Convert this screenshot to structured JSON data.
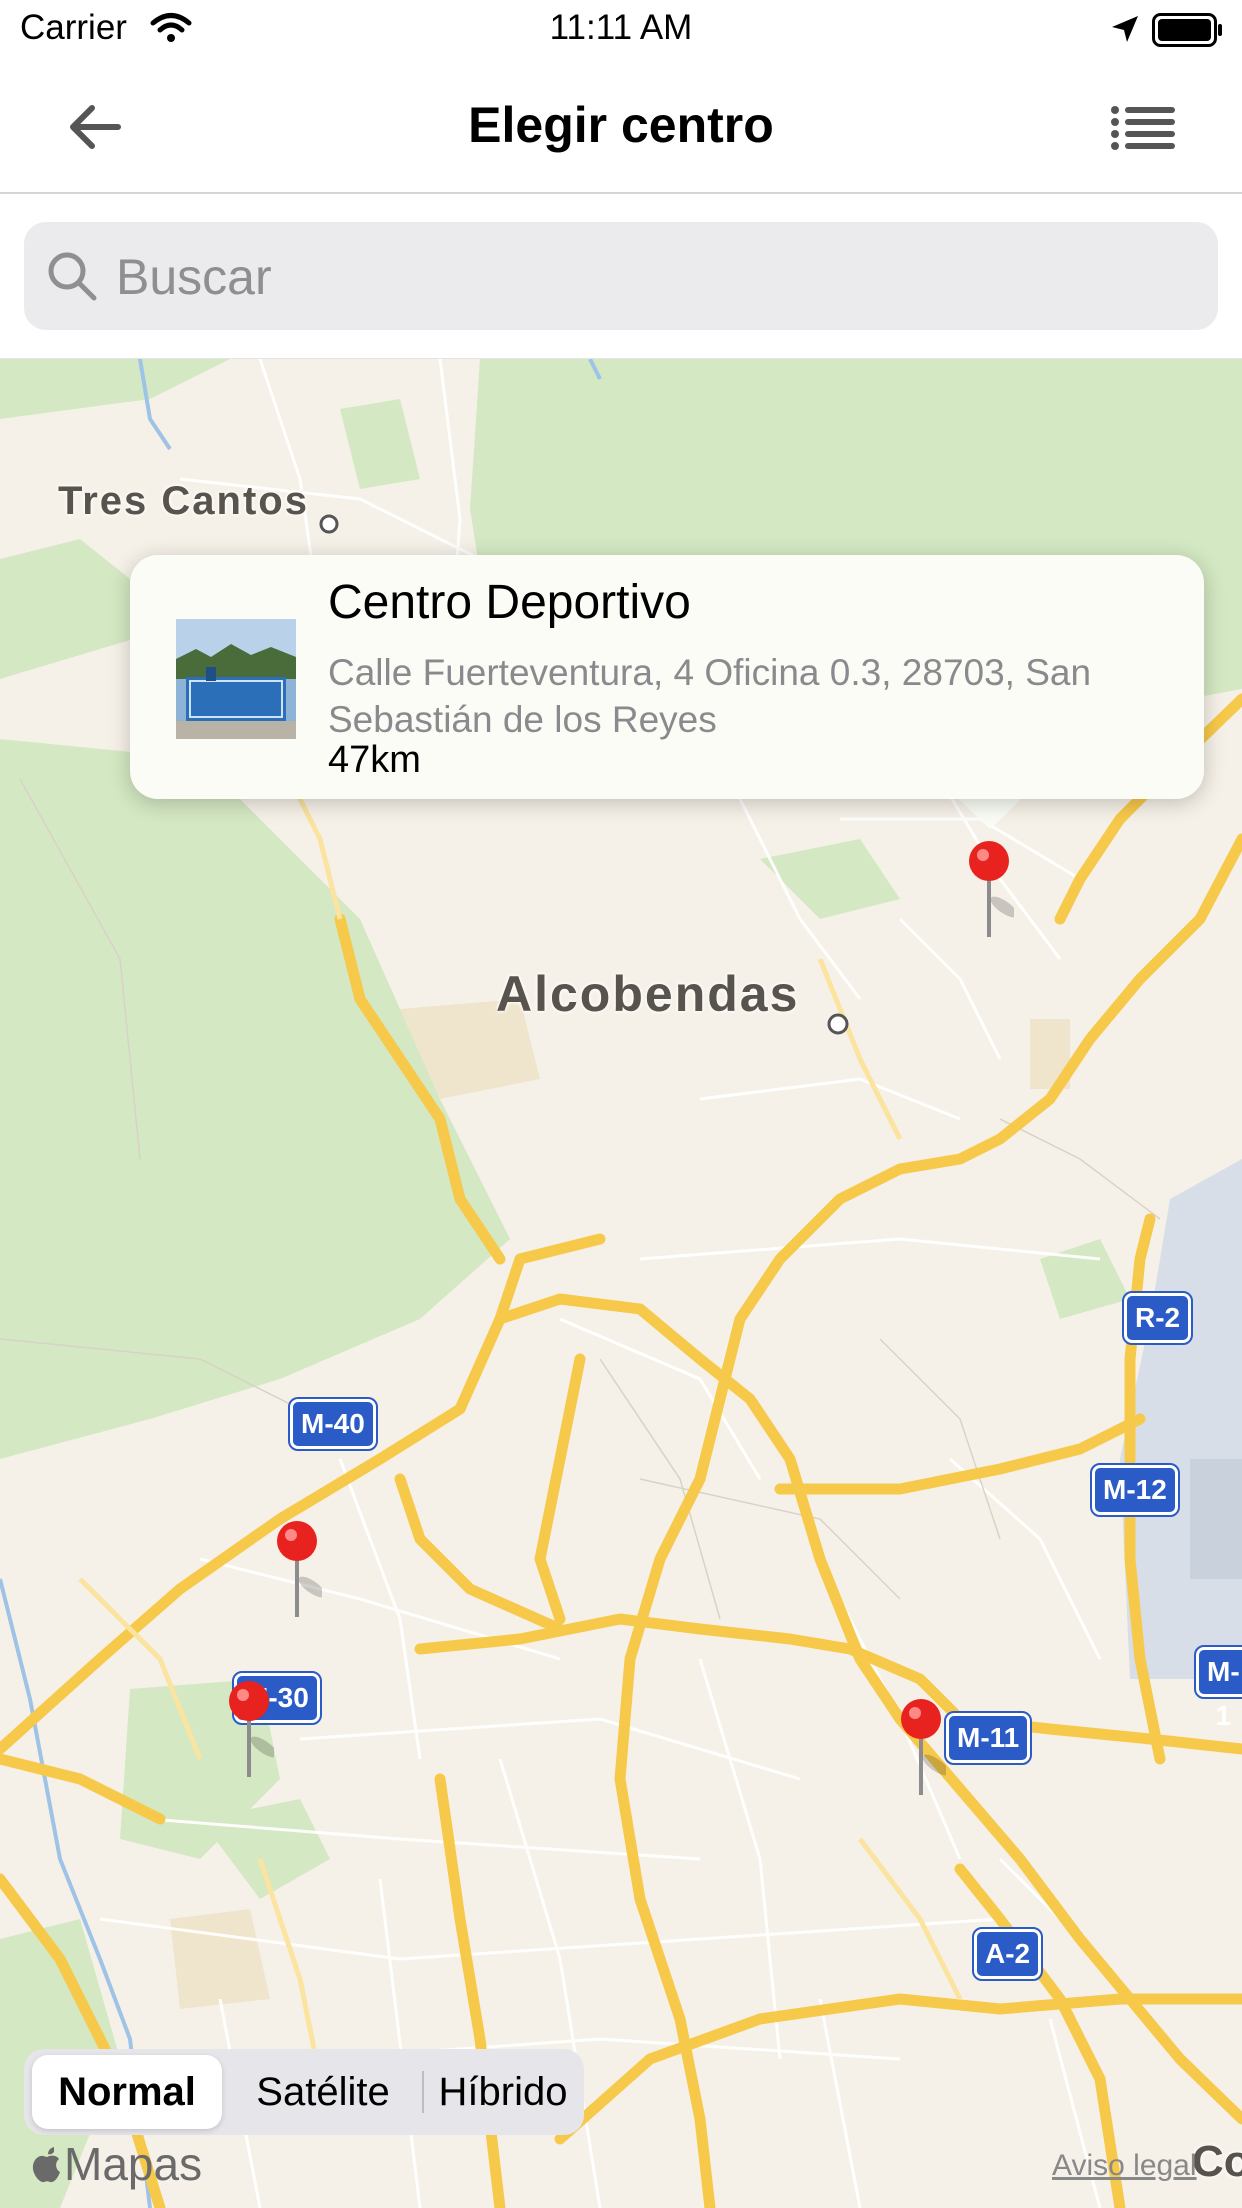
{
  "status_bar": {
    "carrier": "Carrier",
    "time": "11:11 AM"
  },
  "nav": {
    "title": "Elegir centro"
  },
  "search": {
    "placeholder": "Buscar",
    "value": ""
  },
  "map": {
    "labels": {
      "tres_cantos": "Tres Cantos",
      "alcobendas": "Alcobendas",
      "edge": "Co"
    },
    "shields": {
      "m40": "M-40",
      "m30": "M-30",
      "m11": "M-11",
      "m12": "M-12",
      "r2": "R-2",
      "a2": "A-2",
      "m1": "M-1"
    },
    "callout": {
      "name": "Centro Deportivo",
      "address": "Calle Fuerteventura, 4 Oficina 0.3, 28703, San Sebastián de los Reyes",
      "distance": "47km"
    },
    "map_type": {
      "options": [
        "Normal",
        "Satélite",
        "Híbrido"
      ],
      "selected": "Normal"
    },
    "attribution": {
      "brand": "Mapas",
      "legal": "Aviso legal"
    },
    "colors": {
      "land": "#f6f1e8",
      "park": "#cfe6bf",
      "highway": "#f7c94a",
      "water": "#c9d6e3",
      "shield": "#2a5bc6",
      "pin": "#e8231f"
    }
  }
}
